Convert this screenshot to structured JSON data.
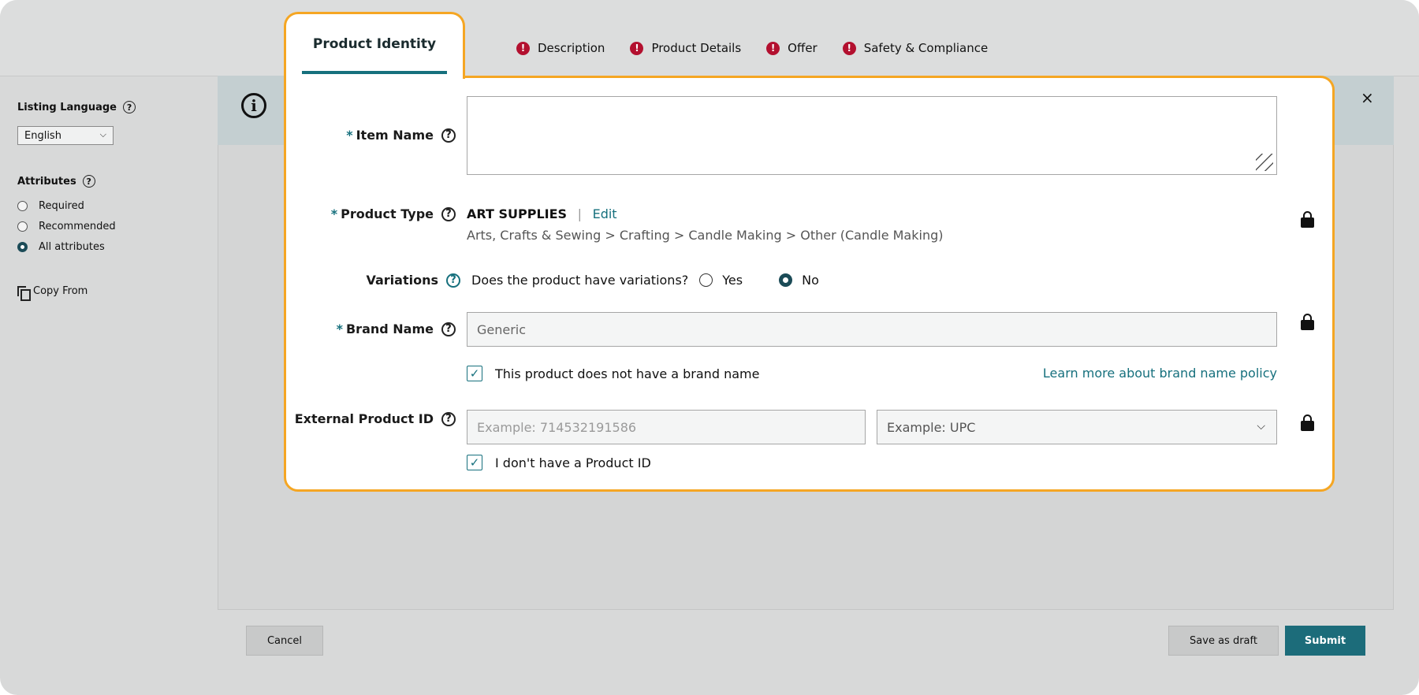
{
  "tabs": {
    "active": "Product Identity",
    "items": [
      {
        "label": "Description"
      },
      {
        "label": "Product Details"
      },
      {
        "label": "Offer"
      },
      {
        "label": "Safety & Compliance"
      }
    ],
    "error_glyph": "!"
  },
  "sidebar": {
    "listing_language_label": "Listing Language",
    "language_value": "English",
    "attributes_label": "Attributes",
    "attribute_options": [
      "Required",
      "Recommended",
      "All attributes"
    ],
    "selected_attribute": "All attributes",
    "copy_from": "Copy From"
  },
  "form": {
    "required_mark": "*",
    "item_name_label": "Item Name",
    "item_name_value": "",
    "product_type_label": "Product Type",
    "product_type_value": "ART SUPPLIES",
    "product_type_separator": "|",
    "product_type_edit": "Edit",
    "product_type_path": "Arts, Crafts & Sewing > Crafting > Candle Making > Other (Candle Making)",
    "variations_label": "Variations",
    "variations_question": "Does the product have variations?",
    "variations_yes": "Yes",
    "variations_no": "No",
    "variations_selected": "No",
    "brand_name_label": "Brand Name",
    "brand_name_value": "Generic",
    "no_brand_checkbox": "This product does not have a brand name",
    "no_brand_checked": true,
    "learn_more_link": "Learn more about brand name policy",
    "external_id_label": "External Product ID",
    "external_id_placeholder": "Example: 714532191586",
    "external_id_type_placeholder": "Example: UPC",
    "no_product_id_checkbox": "I don't have a Product ID",
    "no_product_id_checked": true
  },
  "buttons": {
    "cancel": "Cancel",
    "save_draft": "Save as draft",
    "submit": "Submit",
    "close": "×"
  },
  "glyphs": {
    "help": "?",
    "info": "i",
    "check": "✓",
    "chevron": "⌵"
  },
  "icons": [
    "help-icon",
    "info-icon",
    "close-icon",
    "lock-icon",
    "error-icon",
    "copy-icon",
    "chevron-down-icon",
    "resize-handle-icon"
  ],
  "colors": {
    "accent": "#16707d",
    "highlight_border": "#f5a623",
    "error": "#b3102f",
    "submit_bg": "#1c6c7a"
  }
}
